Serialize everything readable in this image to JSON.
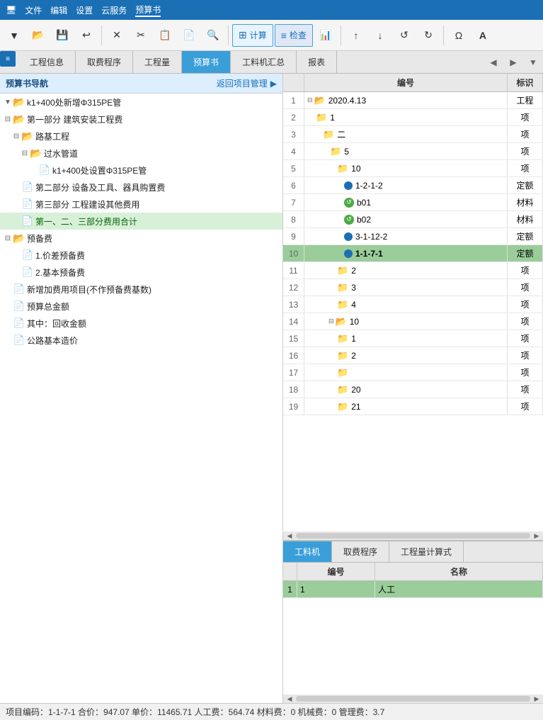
{
  "titleBar": {
    "menus": [
      "文件",
      "编辑",
      "设置",
      "云服务",
      "预算书"
    ]
  },
  "tabBar": {
    "tabs": [
      {
        "label": "工程信息",
        "active": false
      },
      {
        "label": "取费程序",
        "active": false
      },
      {
        "label": "工程量",
        "active": false
      },
      {
        "label": "预算书",
        "active": true
      },
      {
        "label": "工料机汇总",
        "active": false
      },
      {
        "label": "报表",
        "active": false
      }
    ],
    "navButtons": [
      "◀",
      "▶",
      "▼"
    ]
  },
  "leftPanel": {
    "title": "预算书导航",
    "backLabel": "返回项目管理",
    "treeItems": [
      {
        "id": 1,
        "level": 0,
        "icon": "folder-open",
        "label": "k1+400处新增Φ315PE管",
        "expanded": true
      },
      {
        "id": 2,
        "level": 0,
        "icon": "folder-open",
        "label": "第一部分 建筑安装工程费",
        "expanded": true,
        "toggle": "minus"
      },
      {
        "id": 3,
        "level": 1,
        "icon": "folder-open",
        "label": "路基工程",
        "expanded": true,
        "toggle": "minus"
      },
      {
        "id": 4,
        "level": 2,
        "icon": "folder-open",
        "label": "过水管道",
        "expanded": true,
        "toggle": "minus"
      },
      {
        "id": 5,
        "level": 3,
        "icon": "doc",
        "label": "k1+400处设置Φ315PE管"
      },
      {
        "id": 6,
        "level": 1,
        "icon": "doc",
        "label": "第二部分 设备及工具、器具购置费"
      },
      {
        "id": 7,
        "level": 1,
        "icon": "doc",
        "label": "第三部分 工程建设其他费用"
      },
      {
        "id": 8,
        "level": 1,
        "icon": "doc",
        "label": "第一、二、三部分费用合计",
        "highlighted": true
      },
      {
        "id": 9,
        "level": 0,
        "icon": "folder-open",
        "label": "预备费",
        "expanded": true,
        "toggle": "minus"
      },
      {
        "id": 10,
        "level": 1,
        "icon": "doc",
        "label": "1.价差预备费"
      },
      {
        "id": 11,
        "level": 1,
        "icon": "doc",
        "label": "2.基本预备费"
      },
      {
        "id": 12,
        "level": 0,
        "icon": "doc",
        "label": "新增加费用项目(不作预备费基数)"
      },
      {
        "id": 13,
        "level": 0,
        "icon": "doc",
        "label": "预算总金额"
      },
      {
        "id": 14,
        "level": 0,
        "icon": "doc",
        "label": "其中：回收金额"
      },
      {
        "id": 15,
        "level": 0,
        "icon": "doc",
        "label": "公路基本造价"
      }
    ]
  },
  "upperTable": {
    "columns": [
      {
        "label": "",
        "width": 30
      },
      {
        "label": "编号",
        "flex": true
      },
      {
        "label": "标识",
        "width": 50
      }
    ],
    "rows": [
      {
        "num": 1,
        "indent": 0,
        "icon": "folder-yellow-open",
        "code": "2020.4.13",
        "mark": "工程"
      },
      {
        "num": 2,
        "indent": 1,
        "icon": "folder-yellow",
        "code": "1",
        "mark": "项"
      },
      {
        "num": 3,
        "indent": 2,
        "icon": "folder-yellow",
        "code": "二",
        "mark": "项"
      },
      {
        "num": 4,
        "indent": 3,
        "icon": "folder-yellow",
        "code": "5",
        "mark": "项"
      },
      {
        "num": 5,
        "indent": 4,
        "icon": "folder-yellow",
        "code": "10",
        "mark": "项"
      },
      {
        "num": 6,
        "indent": 5,
        "icon": "dot-blue",
        "code": "1-2-1-2",
        "mark": "定额"
      },
      {
        "num": 7,
        "indent": 5,
        "icon": "dot-green",
        "code": "b01",
        "mark": "材料"
      },
      {
        "num": 8,
        "indent": 5,
        "icon": "dot-green",
        "code": "b02",
        "mark": "材料"
      },
      {
        "num": 9,
        "indent": 5,
        "icon": "dot-blue",
        "code": "3-1-12-2",
        "mark": "定额"
      },
      {
        "num": 10,
        "indent": 5,
        "icon": "dot-blue",
        "code": "1-1-7-1",
        "mark": "定额",
        "active": true
      },
      {
        "num": 11,
        "indent": 4,
        "icon": "folder-yellow",
        "code": "2",
        "mark": "项"
      },
      {
        "num": 12,
        "indent": 4,
        "icon": "folder-yellow",
        "code": "3",
        "mark": "项"
      },
      {
        "num": 13,
        "indent": 4,
        "icon": "folder-yellow",
        "code": "4",
        "mark": "项"
      },
      {
        "num": 14,
        "indent": 3,
        "icon": "folder-yellow-open",
        "code": "10",
        "mark": "项"
      },
      {
        "num": 15,
        "indent": 4,
        "icon": "folder-yellow",
        "code": "1",
        "mark": "项"
      },
      {
        "num": 16,
        "indent": 4,
        "icon": "folder-yellow",
        "code": "2",
        "mark": "项"
      },
      {
        "num": 17,
        "indent": 4,
        "icon": "folder-yellow",
        "code": "",
        "mark": "项"
      },
      {
        "num": 18,
        "indent": 4,
        "icon": "folder-yellow",
        "code": "20",
        "mark": "项"
      },
      {
        "num": 19,
        "indent": 4,
        "icon": "folder-yellow",
        "code": "21",
        "mark": "项"
      }
    ]
  },
  "lowerPanel": {
    "tabs": [
      {
        "label": "工料机",
        "active": true
      },
      {
        "label": "取费程序",
        "active": false
      },
      {
        "label": "工程量计算式",
        "active": false
      }
    ],
    "columns": [
      {
        "label": "",
        "width": 20
      },
      {
        "label": "编号",
        "width": 110
      },
      {
        "label": "名称",
        "flex": true
      }
    ],
    "rows": [
      {
        "num": 1,
        "code": "1",
        "name": "人工",
        "active": true
      }
    ]
  },
  "statusBar": {
    "text": "项目编码：1-1-7-1  合价：947.07  单价：11465.71  人工费：564.74  材料费：0  机械费：0  管理费：3.7"
  },
  "toolbar": {
    "buttons": [
      "▼",
      "←",
      "💾",
      "✕",
      "✂",
      "📋",
      "🔍",
      "計算",
      "检查",
      "📊",
      "↑",
      "↓",
      "↺",
      "↻",
      "Ω",
      "A"
    ]
  }
}
